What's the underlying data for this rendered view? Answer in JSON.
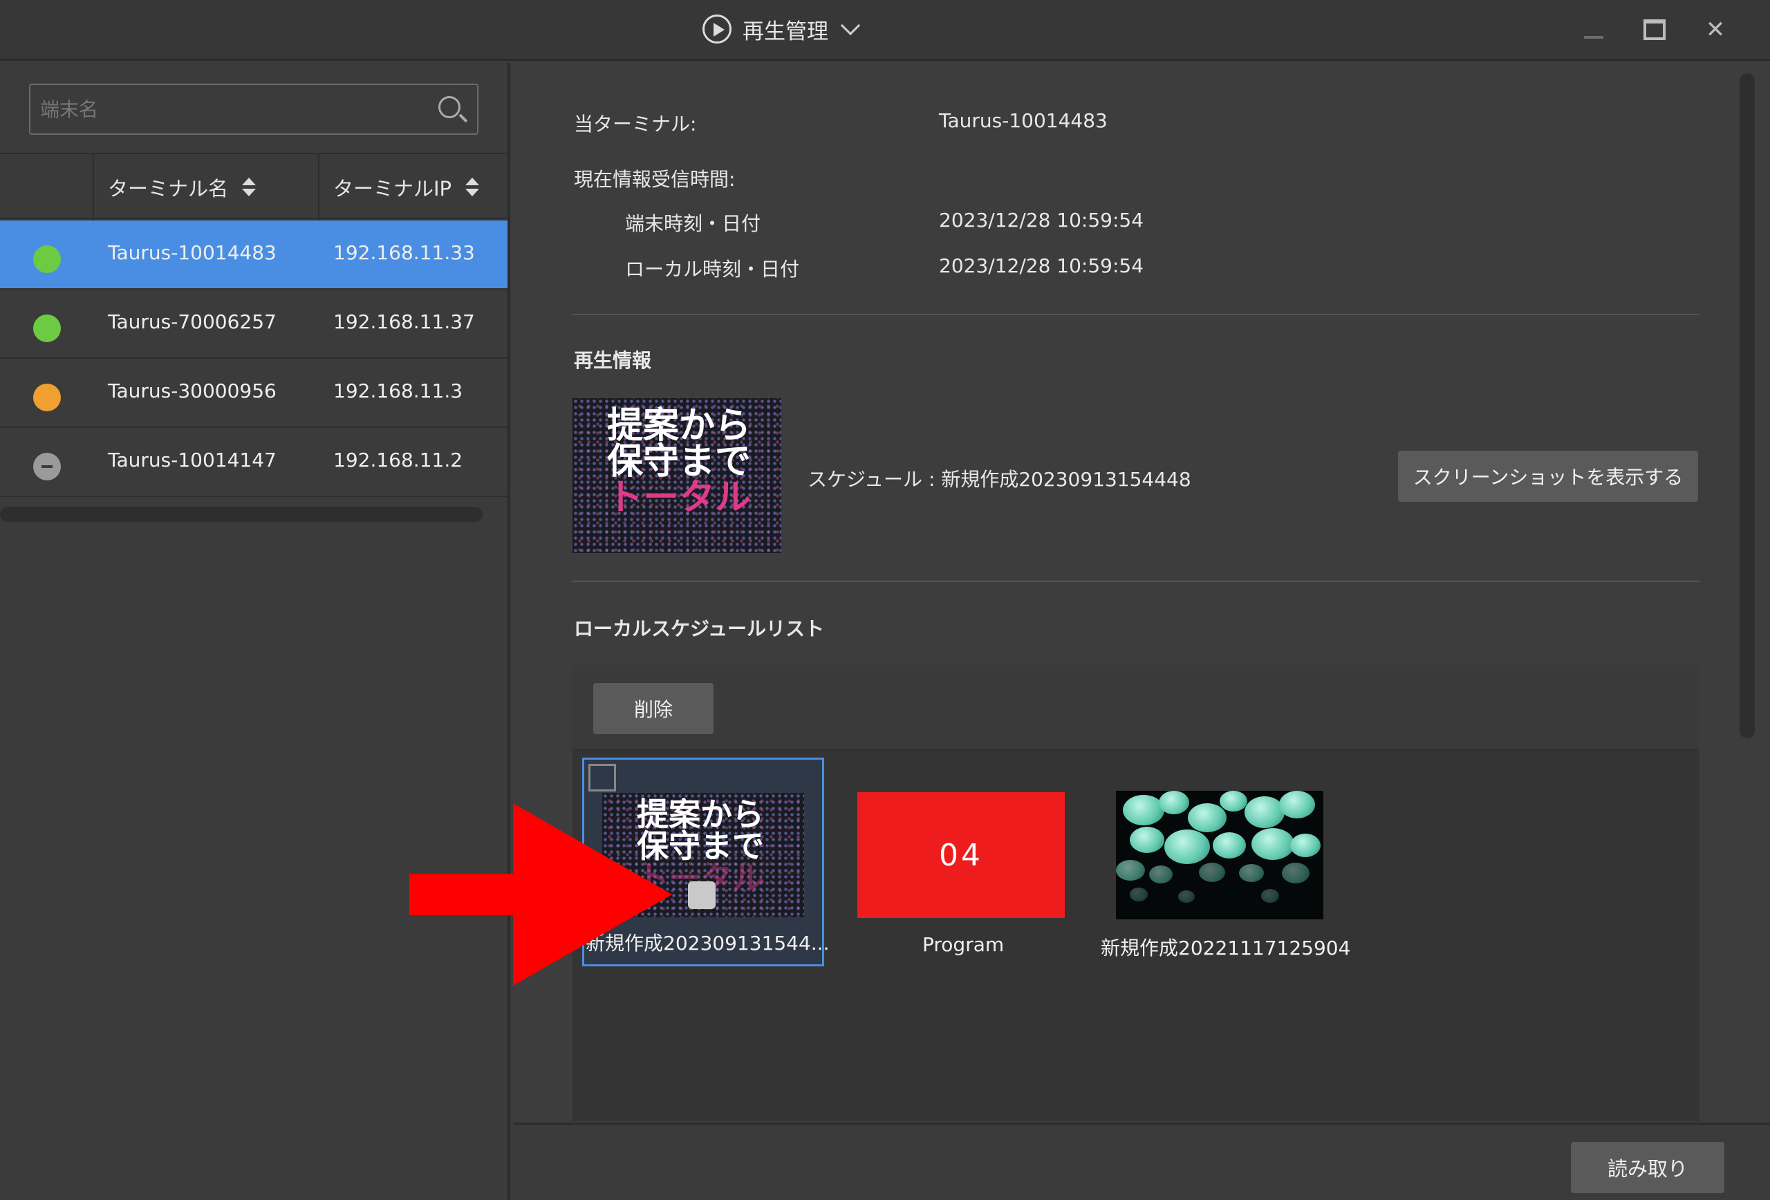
{
  "titlebar": {
    "title": "再生管理",
    "icons": [
      "play-circle-icon",
      "chevron-down-icon",
      "minimize-icon",
      "maximize-icon",
      "close-icon"
    ],
    "close_glyph": "✕"
  },
  "sidebar": {
    "search_placeholder": "端末名",
    "columns": {
      "name": "ターミナル名",
      "ip": "ターミナルIP"
    },
    "terminals": [
      {
        "name": "Taurus-10014483",
        "ip": "192.168.11.33",
        "status_color": "#6ccb43",
        "selected": true
      },
      {
        "name": "Taurus-70006257",
        "ip": "192.168.11.37",
        "status_color": "#6ccb43",
        "selected": false
      },
      {
        "name": "Taurus-30000956",
        "ip": "192.168.11.3",
        "status_color": "#f0a030",
        "selected": false
      },
      {
        "name": "Taurus-10014147",
        "ip": "192.168.11.2",
        "status_color": "#9a9a9a",
        "selected": false
      }
    ]
  },
  "info": {
    "current_terminal_label": "当ターミナル:",
    "current_terminal_value": "Taurus-10014483",
    "receive_time_label": "現在情報受信時間:",
    "device_time_label": "端末時刻・日付",
    "device_time_value": "2023/12/28 10:59:54",
    "local_time_label": "ローカル時刻・日付",
    "local_time_value": "2023/12/28 10:59:54"
  },
  "playback": {
    "section_title": "再生情報",
    "thumbnail_text": {
      "line1": "提案から",
      "line2": "保守まで",
      "line3": "トータル"
    },
    "schedule_text": "スケジュール : 新規作成20230913154448",
    "screenshot_button": "スクリーンショットを表示する"
  },
  "local_list": {
    "section_title": "ローカルスケジュールリスト",
    "delete_button": "削除",
    "items": [
      {
        "caption": "新規作成202309131544...",
        "tile_text": ""
      },
      {
        "caption": "Program",
        "tile_text": "04"
      },
      {
        "caption": "新規作成20221117125904",
        "tile_text": ""
      }
    ]
  },
  "footer": {
    "read_button": "読み取り"
  },
  "colors": {
    "accent": "#4a8ee3",
    "arrow": "#ff0000",
    "program_tile": "#ee1c1c"
  }
}
